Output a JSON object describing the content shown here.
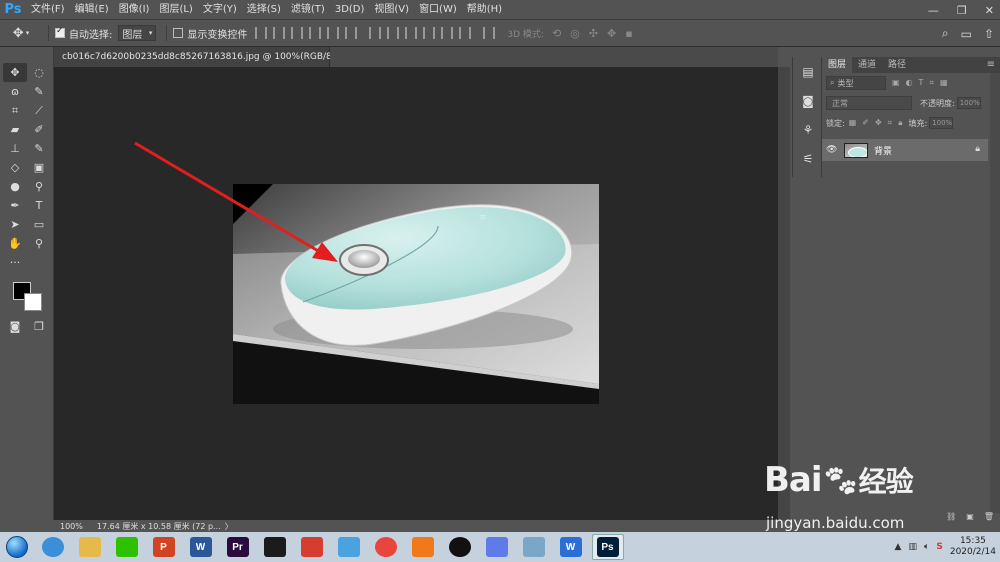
{
  "app": {
    "logo": "Ps"
  },
  "menu": [
    "文件(F)",
    "编辑(E)",
    "图像(I)",
    "图层(L)",
    "文字(Y)",
    "选择(S)",
    "滤镜(T)",
    "3D(D)",
    "视图(V)",
    "窗口(W)",
    "帮助(H)"
  ],
  "window_controls": {
    "minimize": "—",
    "restore": "❐",
    "close": "✕"
  },
  "options": {
    "auto_select_label": "自动选择:",
    "auto_select_checked": true,
    "auto_select_value": "图层",
    "show_transform_label": "显示变换控件",
    "show_transform_checked": false,
    "mode3d_label": "3D 模式:"
  },
  "document": {
    "tab_title": "cb016c7d6200b0235dd8c85267163816.jpg @ 100%(RGB/8#)",
    "close": "×"
  },
  "status": {
    "zoom": "100%",
    "info": "17.64 厘米 x 10.58 厘米 (72 p...",
    "arrow": "〉"
  },
  "layers_panel": {
    "tabs": [
      "图层",
      "通道",
      "路径"
    ],
    "kind_placeholder": "类型",
    "blend_mode": "正常",
    "opacity_label": "不透明度:",
    "opacity_value": "100%",
    "lock_label": "锁定:",
    "fill_label": "填充:",
    "fill_value": "100%",
    "layers": [
      {
        "name": "背景",
        "visible": true,
        "locked": true
      }
    ]
  },
  "taskbar": {
    "apps": [
      {
        "name": "ie",
        "label": "",
        "color": "#3b8ed8"
      },
      {
        "name": "explorer",
        "label": "",
        "color": "#e6b94a"
      },
      {
        "name": "wechat",
        "label": "",
        "color": "#2dc100"
      },
      {
        "name": "powerpoint",
        "label": "P",
        "color": "#d04423"
      },
      {
        "name": "word",
        "label": "W",
        "color": "#2b5797"
      },
      {
        "name": "premiere",
        "label": "Pr",
        "color": "#2a0b3d"
      },
      {
        "name": "video",
        "label": "",
        "color": "#1b1b1b"
      },
      {
        "name": "app-red",
        "label": "",
        "color": "#d43d2f"
      },
      {
        "name": "app-blue",
        "label": "",
        "color": "#4aa3e0"
      },
      {
        "name": "chrome",
        "label": "",
        "color": "#e8453c"
      },
      {
        "name": "app-orange",
        "label": "",
        "color": "#f07a1a"
      },
      {
        "name": "qq",
        "label": "",
        "color": "#111111"
      },
      {
        "name": "app-plane",
        "label": "",
        "color": "#5e7be8"
      },
      {
        "name": "app-note",
        "label": "",
        "color": "#7aa7c7"
      },
      {
        "name": "wps",
        "label": "W",
        "color": "#2b6fd6"
      },
      {
        "name": "photoshop",
        "label": "Ps",
        "color": "#001e36"
      }
    ],
    "clock_time": "15:35",
    "clock_date": "2020/2/14"
  },
  "watermark": {
    "brand": "Bai",
    "brand_suffix": "经验",
    "url": "jingyan.baidu.com"
  },
  "colors": {
    "ui_bg": "#535353",
    "canvas_bg": "#282828",
    "arrow": "#e31e1e",
    "mouse_top": "#bfe6e2"
  }
}
